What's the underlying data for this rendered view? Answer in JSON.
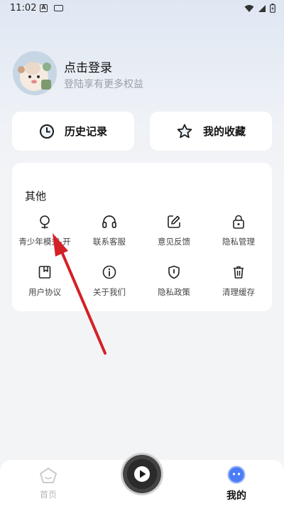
{
  "status_bar": {
    "time": "11:02",
    "a_icon_text": "A"
  },
  "profile": {
    "title": "点击登录",
    "subtitle": "登陆享有更多权益"
  },
  "quick_actions": [
    {
      "label": "历史记录",
      "icon": "clock-icon"
    },
    {
      "label": "我的收藏",
      "icon": "star-icon"
    }
  ],
  "other_section": {
    "title": "其他",
    "items": [
      {
        "label": "青少年模式-开",
        "icon": "teen-mode-icon"
      },
      {
        "label": "联系客服",
        "icon": "headphones-icon"
      },
      {
        "label": "意见反馈",
        "icon": "feedback-edit-icon"
      },
      {
        "label": "隐私管理",
        "icon": "lock-icon"
      },
      {
        "label": "用户协议",
        "icon": "bookmark-doc-icon"
      },
      {
        "label": "关于我们",
        "icon": "info-icon"
      },
      {
        "label": "隐私政策",
        "icon": "shield-icon"
      },
      {
        "label": "清理缓存",
        "icon": "trash-icon"
      }
    ]
  },
  "bottom_nav": {
    "home_label": "首页",
    "mine_label": "我的"
  },
  "colors": {
    "annotation_arrow": "#d42027",
    "mine_accent": "#4a7cf5",
    "muted_text": "#9a9ea6"
  }
}
